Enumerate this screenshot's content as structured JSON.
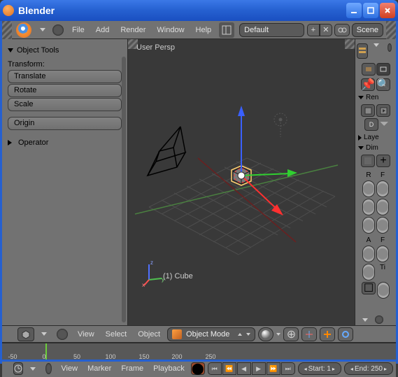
{
  "window": {
    "title": "Blender"
  },
  "header": {
    "menu": [
      "File",
      "Add",
      "Render",
      "Window",
      "Help"
    ],
    "layout_label": "Default",
    "scene_label": "Scene"
  },
  "toolpanel": {
    "title": "Object Tools",
    "transform_label": "Transform:",
    "buttons": {
      "translate": "Translate",
      "rotate": "Rotate",
      "scale": "Scale",
      "origin": "Origin"
    },
    "operator_title": "Operator"
  },
  "viewport": {
    "persp_label": "User Persp",
    "object_name": "(1) Cube",
    "axis_labels": {
      "x": "x",
      "y": "y",
      "z": "z"
    },
    "bottom_menu": [
      "View",
      "Select",
      "Object"
    ],
    "mode": "Object Mode"
  },
  "rightpanel": {
    "sections": {
      "ren": "Ren",
      "laye": "Laye",
      "dim": "Dim"
    },
    "labels": {
      "d": "D",
      "r": "R",
      "f": "F",
      "a": "A",
      "ti": "Ti"
    }
  },
  "timeline": {
    "ticks": [
      "-50",
      "0",
      "50",
      "100",
      "150",
      "200",
      "250"
    ],
    "current": 1,
    "footer_menu": [
      "View",
      "Marker",
      "Frame",
      "Playback"
    ],
    "start_label": "Start:",
    "start_value": "1",
    "end_label": "End:",
    "end_value": "250"
  }
}
